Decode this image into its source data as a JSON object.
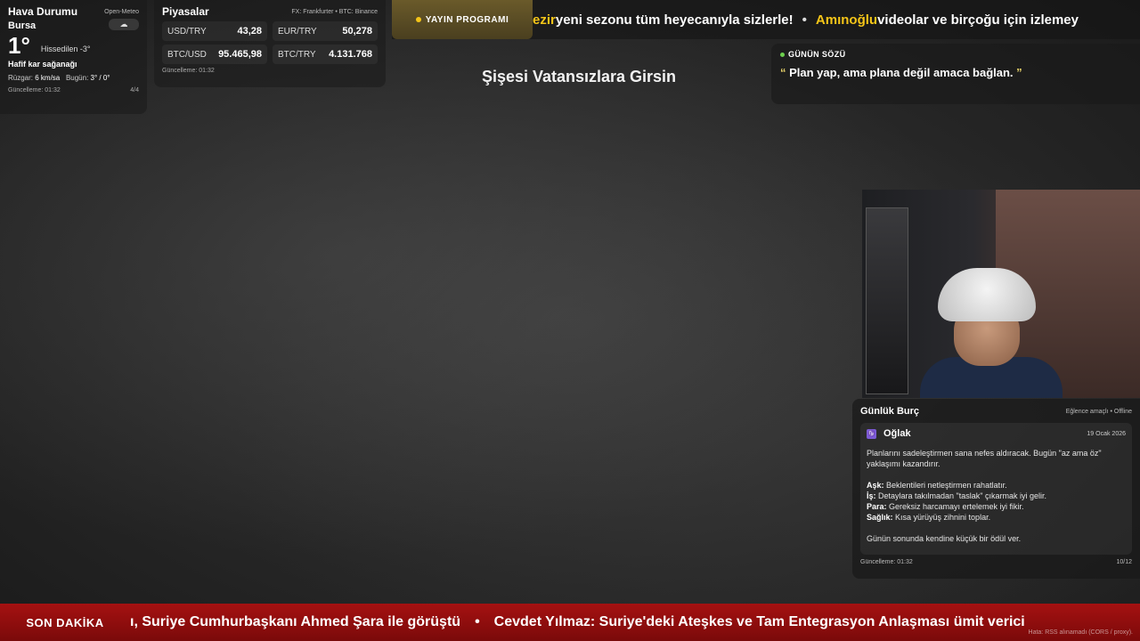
{
  "weather": {
    "title": "Hava Durumu",
    "source": "Open-Meteo",
    "city": "Bursa",
    "icon": "snow-cloud-icon",
    "icon_glyph": "☁",
    "temp": "1°",
    "feels": "Hissedilen -3°",
    "condition": "Hafif kar sağanağı",
    "wind_label": "Rüzgar:",
    "wind_value": "6 km/sa",
    "today_label": "Bugün:",
    "today_value": "3° / 0°",
    "updated": "Güncelleme: 01:32",
    "page": "4/4"
  },
  "markets": {
    "title": "Piyasalar",
    "source": "FX: Frankfurter • BTC: Binance",
    "items": [
      {
        "symbol": "USD/TRY",
        "value": "43,28"
      },
      {
        "symbol": "EUR/TRY",
        "value": "50,278"
      },
      {
        "symbol": "BTC/USD",
        "value": "95.465,98"
      },
      {
        "symbol": "BTC/TRY",
        "value": "4.131.768"
      }
    ],
    "updated": "Güncelleme: 01:32"
  },
  "top_ticker": {
    "program_label": "YAYIN PROGRAMI",
    "hl1": "ezir",
    "text1": " yeni sezonu tüm heyecanıyla sizlerle!",
    "sep": "•",
    "hl2": "Amınoğlu",
    "text2": " videolar ve birçoğu için izlemey"
  },
  "stream_title": "Şişesi Vatansızlara Girsin",
  "quote": {
    "label": "GÜNÜN SÖZÜ",
    "open": "“",
    "text": " Plan yap, ama plana değil amaca bağlan. ",
    "close": "”"
  },
  "horoscope": {
    "title": "Günlük Burç",
    "source": "Eğlence amaçlı • Offline",
    "sign_glyph": "♑",
    "sign": "Oğlak",
    "date": "19 Ocak 2026",
    "intro": "Planlarını sadeleştirmen sana nefes aldıracak. Bugün \"az ama öz\" yaklaşımı kazandırır.",
    "love_label": "Aşk:",
    "love": " Beklentileri netleştirmen rahatlatır.",
    "work_label": "İş:",
    "work": " Detaylara takılmadan \"taslak\" çıkarmak iyi gelir.",
    "money_label": "Para:",
    "money": " Gereksiz harcamayı ertelemek iyi fikir.",
    "health_label": "Sağlık:",
    "health": " Kısa yürüyüş zihnini toplar.",
    "closing": "Günün sonunda kendine küçük bir ödül ver.",
    "updated": "Güncelleme: 01:32",
    "page": "10/12"
  },
  "breaking": {
    "label": "SON DAKİKA",
    "item1": "ı, Suriye Cumhurbaşkanı Ahmed Şara ile görüştü",
    "sep": "•",
    "item2": "Cevdet Yılmaz: Suriye'deki Ateşkes ve Tam Entegrasyon Anlaşması ümit verici",
    "error": "Hata: RSS alınamadı (CORS / proxy)."
  },
  "colors": {
    "accent_yellow": "#f5c518",
    "breaking_red": "#a51111",
    "quote_dot": "#6ccf4d"
  }
}
